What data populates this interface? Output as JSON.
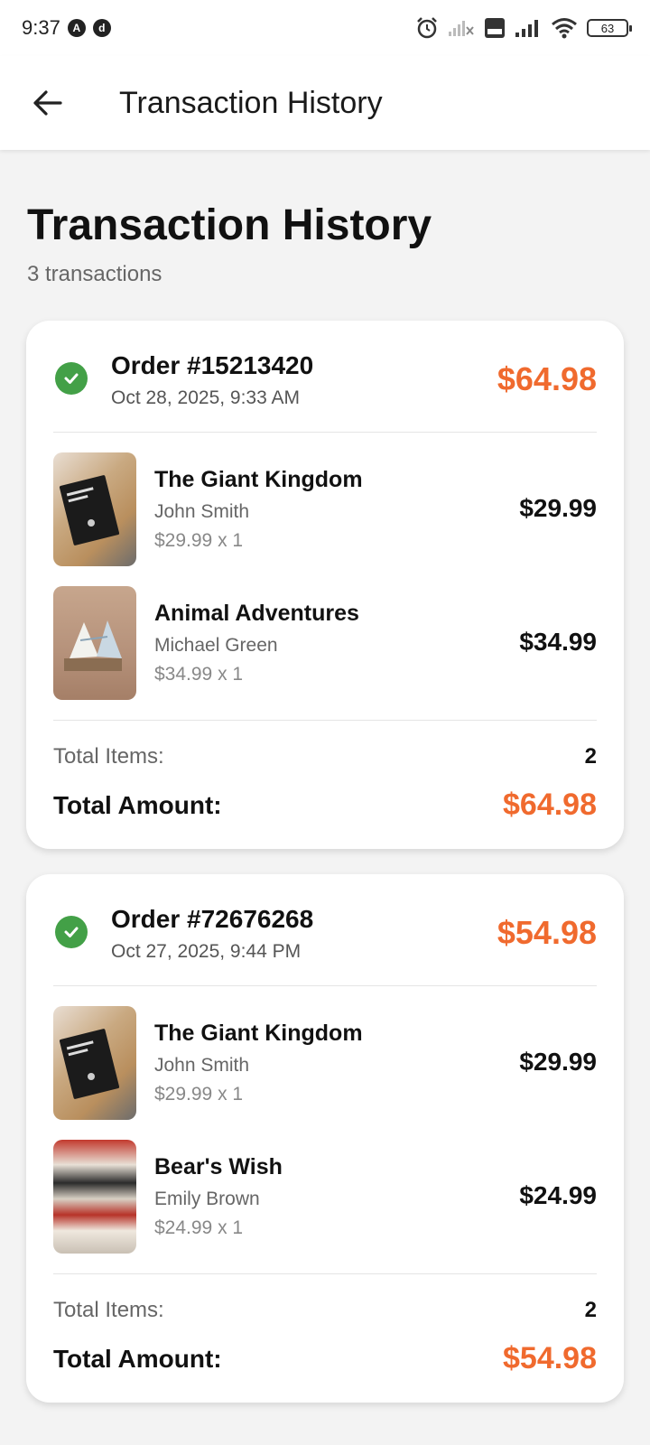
{
  "status_bar": {
    "time": "9:37",
    "battery": "63"
  },
  "app_bar": {
    "title": "Transaction History"
  },
  "page": {
    "title": "Transaction History",
    "subtitle": "3 transactions"
  },
  "orders": [
    {
      "number": "Order #15213420",
      "date": "Oct 28, 2025, 9:33 AM",
      "total": "$64.98",
      "items": [
        {
          "title": "The Giant Kingdom",
          "author": "John Smith",
          "qty": "$29.99 x 1",
          "price": "$29.99",
          "cover": "book-cover-milk-and-honey"
        },
        {
          "title": "Animal Adventures",
          "author": "Michael Green",
          "qty": "$34.99 x 1",
          "price": "$34.99",
          "cover": "book-cover-open-book"
        }
      ],
      "total_items_label": "Total Items:",
      "total_items": "2",
      "total_amount_label": "Total Amount:",
      "total_amount": "$64.98"
    },
    {
      "number": "Order #72676268",
      "date": "Oct 27, 2025, 9:44 PM",
      "total": "$54.98",
      "items": [
        {
          "title": "The Giant Kingdom",
          "author": "John Smith",
          "qty": "$29.99 x 1",
          "price": "$29.99",
          "cover": "book-cover-milk-and-honey"
        },
        {
          "title": "Bear's Wish",
          "author": "Emily Brown",
          "qty": "$24.99 x 1",
          "price": "$24.99",
          "cover": "book-cover-stack"
        }
      ],
      "total_items_label": "Total Items:",
      "total_items": "2",
      "total_amount_label": "Total Amount:",
      "total_amount": "$54.98"
    }
  ],
  "colors": {
    "accent": "#f06a2e",
    "success": "#43a047",
    "background": "#f3f3f3"
  },
  "icons": {
    "back": "arrow-left-icon",
    "status": "check-circle-icon"
  }
}
